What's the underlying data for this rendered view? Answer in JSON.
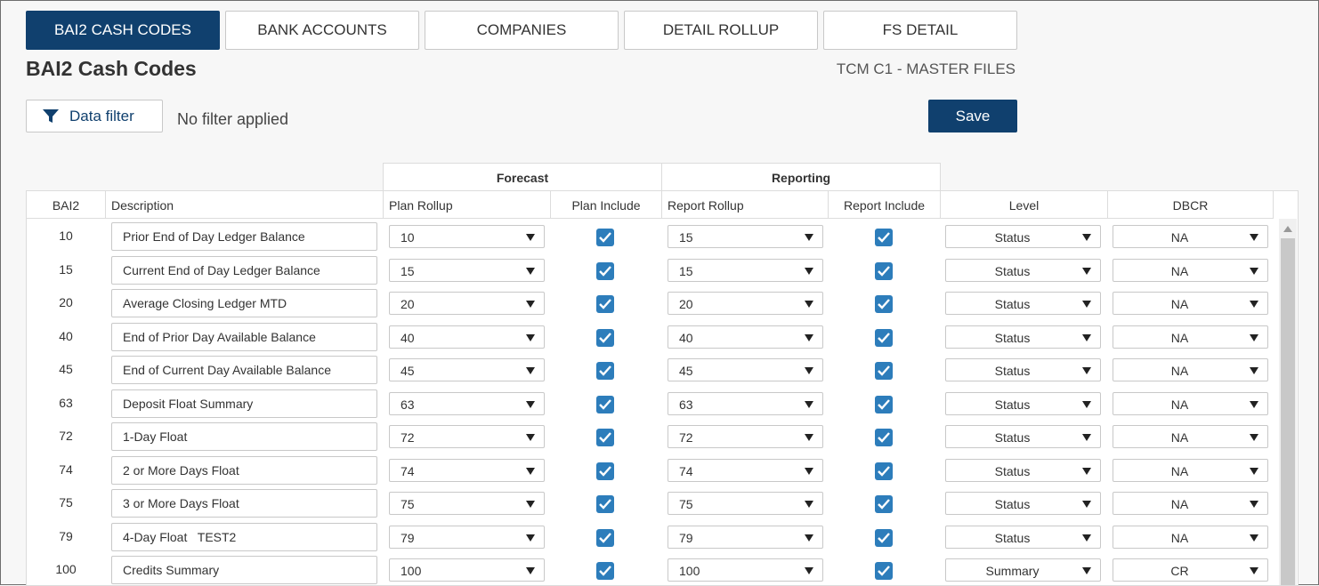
{
  "tabs": [
    {
      "label": "BAI2 CASH CODES",
      "active": true
    },
    {
      "label": "BANK ACCOUNTS",
      "active": false
    },
    {
      "label": "COMPANIES",
      "active": false
    },
    {
      "label": "DETAIL ROLLUP",
      "active": false
    },
    {
      "label": "FS DETAIL",
      "active": false
    }
  ],
  "page": {
    "title": "BAI2 Cash Codes",
    "context": "TCM C1 - MASTER FILES"
  },
  "toolbar": {
    "filter_label": "Data filter",
    "filter_status": "No filter applied",
    "save_label": "Save"
  },
  "grid": {
    "group_headers": {
      "forecast": "Forecast",
      "reporting": "Reporting"
    },
    "columns": {
      "bai2": "BAI2",
      "description": "Description",
      "plan_rollup": "Plan Rollup",
      "plan_include": "Plan Include",
      "report_rollup": "Report Rollup",
      "report_include": "Report Include",
      "level": "Level",
      "dbcr": "DBCR"
    },
    "rows": [
      {
        "code": "10",
        "description": "Prior End of Day Ledger Balance",
        "plan_rollup": "10",
        "plan_include": true,
        "report_rollup": "15",
        "report_include": true,
        "level": "Status",
        "dbcr": "NA"
      },
      {
        "code": "15",
        "description": "Current End of Day Ledger Balance",
        "plan_rollup": "15",
        "plan_include": true,
        "report_rollup": "15",
        "report_include": true,
        "level": "Status",
        "dbcr": "NA"
      },
      {
        "code": "20",
        "description": "Average Closing Ledger MTD",
        "plan_rollup": "20",
        "plan_include": true,
        "report_rollup": "20",
        "report_include": true,
        "level": "Status",
        "dbcr": "NA"
      },
      {
        "code": "40",
        "description": "End of Prior Day Available Balance",
        "plan_rollup": "40",
        "plan_include": true,
        "report_rollup": "40",
        "report_include": true,
        "level": "Status",
        "dbcr": "NA"
      },
      {
        "code": "45",
        "description": "End of Current Day Available Balance",
        "plan_rollup": "45",
        "plan_include": true,
        "report_rollup": "45",
        "report_include": true,
        "level": "Status",
        "dbcr": "NA"
      },
      {
        "code": "63",
        "description": "Deposit Float Summary",
        "plan_rollup": "63",
        "plan_include": true,
        "report_rollup": "63",
        "report_include": true,
        "level": "Status",
        "dbcr": "NA"
      },
      {
        "code": "72",
        "description": "1-Day Float",
        "plan_rollup": "72",
        "plan_include": true,
        "report_rollup": "72",
        "report_include": true,
        "level": "Status",
        "dbcr": "NA"
      },
      {
        "code": "74",
        "description": "2 or More Days Float",
        "plan_rollup": "74",
        "plan_include": true,
        "report_rollup": "74",
        "report_include": true,
        "level": "Status",
        "dbcr": "NA"
      },
      {
        "code": "75",
        "description": "3 or More Days Float",
        "plan_rollup": "75",
        "plan_include": true,
        "report_rollup": "75",
        "report_include": true,
        "level": "Status",
        "dbcr": "NA"
      },
      {
        "code": "79",
        "description": "4-Day Float   TEST2",
        "plan_rollup": "79",
        "plan_include": true,
        "report_rollup": "79",
        "report_include": true,
        "level": "Status",
        "dbcr": "NA"
      },
      {
        "code": "100",
        "description": "Credits Summary",
        "plan_rollup": "100",
        "plan_include": true,
        "report_rollup": "100",
        "report_include": true,
        "level": "Summary",
        "dbcr": "CR"
      }
    ]
  },
  "icons": {
    "filter": "filter-funnel-icon",
    "dropdown": "chevron-down-icon",
    "check": "checkmark-icon"
  },
  "colors": {
    "primary": "#10406e",
    "checkbox": "#2d7dbb"
  }
}
